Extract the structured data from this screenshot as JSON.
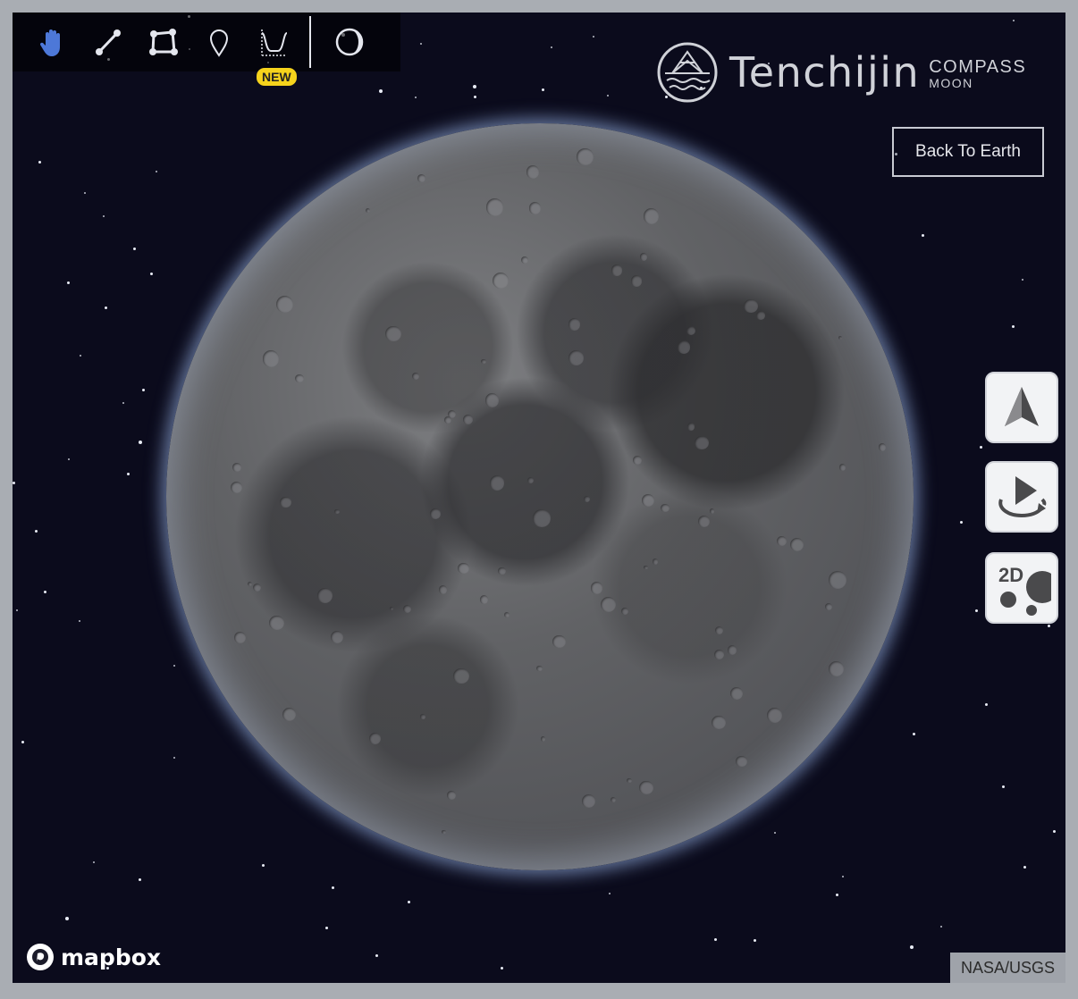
{
  "toolbar": {
    "tools": [
      {
        "name": "hand-icon",
        "active": true
      },
      {
        "name": "line-measure-icon",
        "active": false
      },
      {
        "name": "polygon-measure-icon",
        "active": false
      },
      {
        "name": "marker-pin-icon",
        "active": false
      },
      {
        "name": "elevation-profile-icon",
        "active": false,
        "badge": "NEW"
      },
      {
        "name": "moon-phase-icon",
        "active": false
      }
    ],
    "badge_label": "NEW",
    "active_color": "#4d78d8"
  },
  "logo": {
    "name": "Tenchijin",
    "sub_top": "COMPASS",
    "sub_bottom": "MOON"
  },
  "back_button": "Back To Earth",
  "controls": {
    "north": "navigation-arrow-icon",
    "rotate": "auto-rotate-play-icon",
    "view_toggle": "2D",
    "view_toggle_icon": "2d-moon-view-icon"
  },
  "footer": {
    "brand": "mapbox",
    "attribution": "NASA/USGS"
  },
  "colors": {
    "space": "#0b0b1c",
    "frame": "#a9adb3",
    "badge": "#f6d31c"
  }
}
